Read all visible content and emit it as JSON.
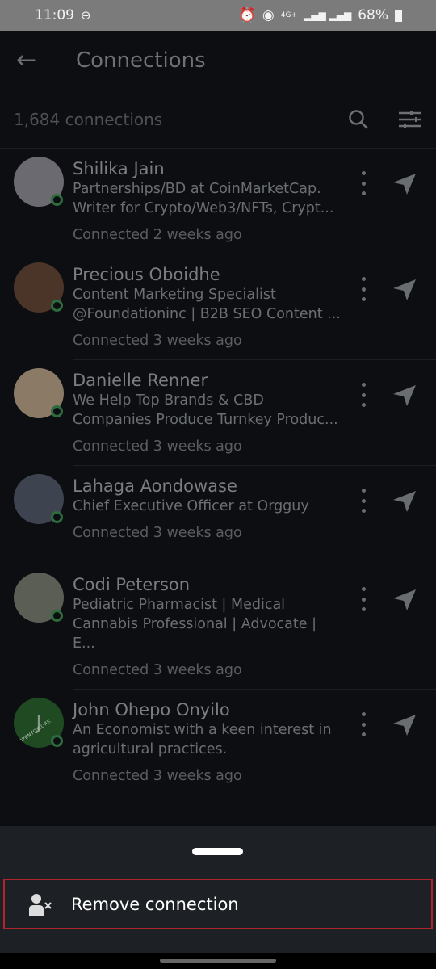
{
  "status": {
    "time": "11:09",
    "network": "4G+",
    "battery": "68%"
  },
  "header": {
    "title": "Connections",
    "back_icon": "arrow-left-icon"
  },
  "subheader": {
    "count": "1,684 connections"
  },
  "connections": [
    {
      "name": "Shilika Jain",
      "desc1": "Partnerships/BD at CoinMarketCap.",
      "desc2": "Writer for Crypto/Web3/NFTs, Crypt...",
      "connected": "Connected 2 weeks ago",
      "avatar": "#6b6a70"
    },
    {
      "name": "Precious Oboidhe",
      "desc1": "Content Marketing Specialist",
      "desc2": "@Foundationinc | B2B SEO Content ...",
      "connected": "Connected 3 weeks ago",
      "avatar": "#4b3428"
    },
    {
      "name": "Danielle Renner",
      "desc1": "We Help Top Brands & CBD",
      "desc2": "Companies Produce Turnkey Produc...",
      "connected": "Connected 3 weeks ago",
      "avatar": "#8a7a66"
    },
    {
      "name": "Lahaga Aondowase",
      "desc1": "Chief Executive Officer at Orgguy",
      "desc2": "",
      "connected": "Connected 3 weeks ago",
      "avatar": "#3d4450"
    },
    {
      "name": "Codi Peterson",
      "desc1": "Pediatric Pharmacist | Medical",
      "desc2": "Cannabis Professional | Advocate | E...",
      "connected": "Connected 3 weeks ago",
      "avatar": "#5a5e55"
    },
    {
      "name": "John  Ohepo Onyilo",
      "desc1": "An Economist with a keen interest in",
      "desc2": "agricultural practices.",
      "connected": "Connected 3 weeks ago",
      "avatar": "#1f4a22",
      "initial": "J",
      "badge": "#OPENTOWORK"
    }
  ],
  "sheet": {
    "remove_label": "Remove connection",
    "accent": "#b0252d"
  }
}
